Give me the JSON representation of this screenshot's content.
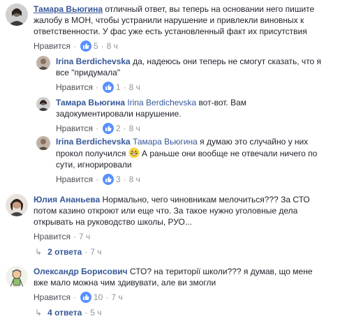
{
  "comments": [
    {
      "author": "Тамара Вьюгина",
      "lines": [
        "отличный ответ, вы теперь на основании него пишите",
        "жалобу в МОН, чтобы устранили нарушение и привлекли виновных к",
        "ответственности. У фас уже есть установленный факт их присутствия"
      ],
      "like_label": "Нравится",
      "likes": "5",
      "time": "8 ч"
    },
    {
      "author": "Irina Berdichevska",
      "lines": [
        "да, надеюсь они теперь не смогут сказать, что я",
        "все \"придумала\""
      ],
      "like_label": "Нравится",
      "likes": "1",
      "time": "8 ч"
    },
    {
      "author": "Тамара Вьюгина",
      "tag": "Irina Berdichevska",
      "lines": [
        "вот-вот. Вам",
        "задокументировали нарушение."
      ],
      "like_label": "Нравится",
      "likes": "2",
      "time": "8 ч"
    },
    {
      "author": "Irina Berdichevska",
      "tag": "Тамара Вьюгина",
      "lines": [
        "я думаю это случайно у них",
        "прокол получился",
        "А раньше они вообще не отвечали ничего по",
        "сути, игнорировали"
      ],
      "like_label": "Нравится",
      "likes": "3",
      "time": "8 ч"
    },
    {
      "author": "Юлия Ананьева",
      "lines": [
        "Нормально, чего чиновникам мелочиться??? За СТО",
        "потом казино откроют или еще что. За такое нужно уголовные дела",
        "открывать на руководство школы, РУО..."
      ],
      "like_label": "Нравится",
      "time": "7 ч",
      "replies_label": "2 ответа",
      "replies_time": "7 ч"
    },
    {
      "author": "Олександр Борисович",
      "lines": [
        "СТО? на території школи??? я думав, що мене",
        "вже мало можна чим здивувати, але ви змогли"
      ],
      "like_label": "Нравится",
      "likes": "10",
      "time": "7 ч",
      "replies_label": "4 ответа",
      "replies_time": "5 ч"
    }
  ],
  "separator": "·",
  "reply_arrow": "↳",
  "colors": {
    "link": "#365899",
    "meta": "#90949c",
    "like_blue": "#5890ff"
  }
}
